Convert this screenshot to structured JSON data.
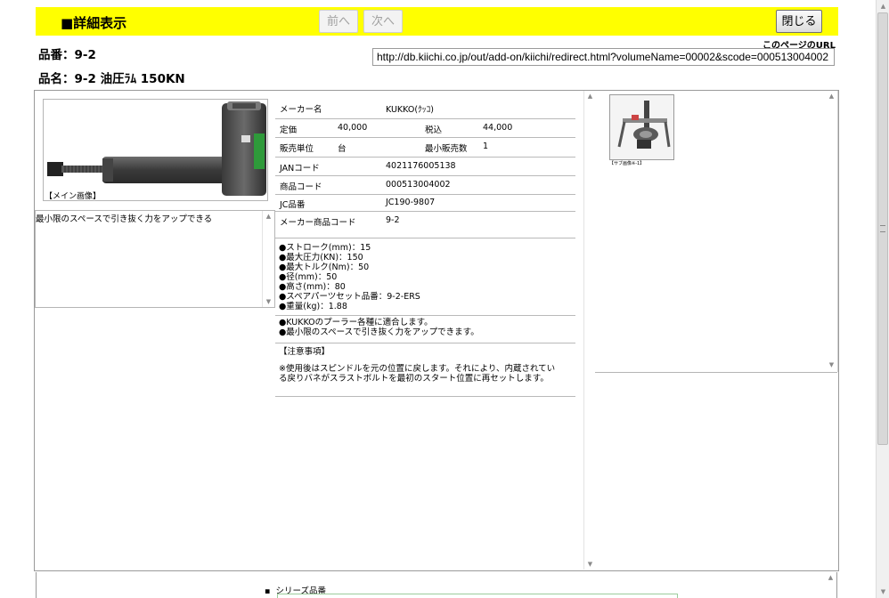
{
  "header": {
    "title": "■詳細表示",
    "prev_label": "前へ",
    "next_label": "次へ",
    "close_label": "閉じる"
  },
  "product": {
    "number_line": "品番：9-2",
    "name_line": "品名：9-2 油圧ﾗﾑ 150KN"
  },
  "page_url": {
    "label": "このページのURL",
    "value": "http://db.kiichi.co.jp/out/add-on/kiichi/redirect.html?volumeName=00002&scode=000513004002"
  },
  "main_image": {
    "caption": "【メイン画像】"
  },
  "description": "最小限のスペースで引き抜く力をアップできる",
  "details": {
    "maker_label": "メーカー名",
    "maker_value": "KUKKO(ｸｯｺ)",
    "list_price_label": "定価",
    "list_price_value": "40,000",
    "tax_incl_label": "税込",
    "tax_incl_value": "44,000",
    "unit_label": "販売単位",
    "unit_value": "台",
    "min_qty_label": "最小販売数",
    "min_qty_value": "1",
    "jan_label": "JANコード",
    "jan_value": "4021176005138",
    "code_label": "商品コード",
    "code_value": "000513004002",
    "jc_label": "JC品番",
    "jc_value": "JC190-9807",
    "maker_code_label": "メーカー商品コード",
    "maker_code_value": "9-2"
  },
  "specs": [
    "●ストローク(mm)：15",
    "●最大圧力(KN)：150",
    "●最大トルク(Nm)：50",
    "●径(mm)：50",
    "●高さ(mm)：80",
    "●スペアパーツセット品番：9-2-ERS",
    "●重量(kg)：1.88"
  ],
  "features": [
    "●KUKKOのプーラー各種に適合します。",
    "●最小限のスペースで引き抜く力をアップできます。"
  ],
  "notes": {
    "heading": "【注意事項】",
    "line1": "※使用後はスピンドルを元の位置に戻します。それにより、内蔵されてい",
    "line2": "る戻りバネがスラストボルトを最初のスタート位置に再セットします。"
  },
  "sub_image": {
    "caption": "【サブ画像※-1】"
  },
  "series": {
    "label": "シリーズ品番"
  }
}
